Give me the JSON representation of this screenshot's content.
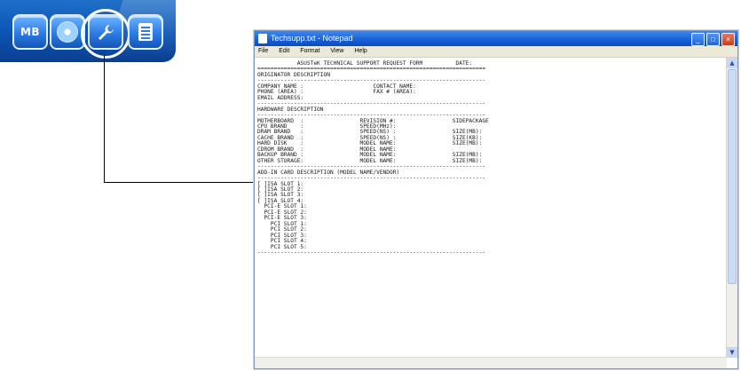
{
  "toolbar": {
    "icons": [
      {
        "name": "mb",
        "label": "MB"
      },
      {
        "name": "cd-icon"
      },
      {
        "name": "tools-icon"
      },
      {
        "name": "document-icon"
      }
    ]
  },
  "window": {
    "title": "Techsupp.txt - Notepad",
    "buttons": {
      "minimize": "_",
      "maximize": "□",
      "close": "×"
    },
    "menu": [
      "File",
      "Edit",
      "Format",
      "View",
      "Help"
    ],
    "text": "            ASUSTeK TECHNICAL SUPPORT REQUEST FORM          DATE:\n=====================================================================\nORIGINATOR DESCRIPTION\n---------------------------------------------------------------------\nCOMPANY NAME :                     CONTACT NAME:\nPHONE (AREA) :                     FAX # (AREA):\nEMAIL ADDRESS:\n---------------------------------------------------------------------\nHARDWARE DESCRIPTION\n---------------------------------------------------------------------\nMOTHERBOARD  :                 REVISION #:                 SIDEPACKAGE\nCPU BRAND    :                 SPEED(MHz):\nDRAM BRAND   :                 SPEED(NS) :                 SIZE(MB):\nCACHE BRAND  :                 SPEED(NS) :                 SIZE(KB):\nHARD DISK    :                 MODEL NAME:                 SIZE(MB):\nCDROM BRAND  :                 MODEL NAME:\nBACKUP BRAND :                 MODEL NAME:                 SIZE(MB):\nOTHER STORAGE:                 MODEL NAME:                 SIZE(MB):\n---------------------------------------------------------------------\nADD-IN CARD DESCRIPTION (MODEL NAME/VENDOR)\n---------------------------------------------------------------------\n[ ]ISA SLOT 1:\n[ ]ISA SLOT 2:\n[ ]ISA SLOT 3:\n[ ]ISA SLOT 4:\n  PCI-E SLOT 1:\n  PCI-E SLOT 2:\n  PCI-E SLOT 3:\n    PCI SLOT 1:\n    PCI SLOT 2:\n    PCI SLOT 3:\n    PCI SLOT 4:\n    PCI SLOT 5:\n---------------------------------------------------------------------",
    "scroll": {
      "up": "▲",
      "down": "▼"
    }
  }
}
